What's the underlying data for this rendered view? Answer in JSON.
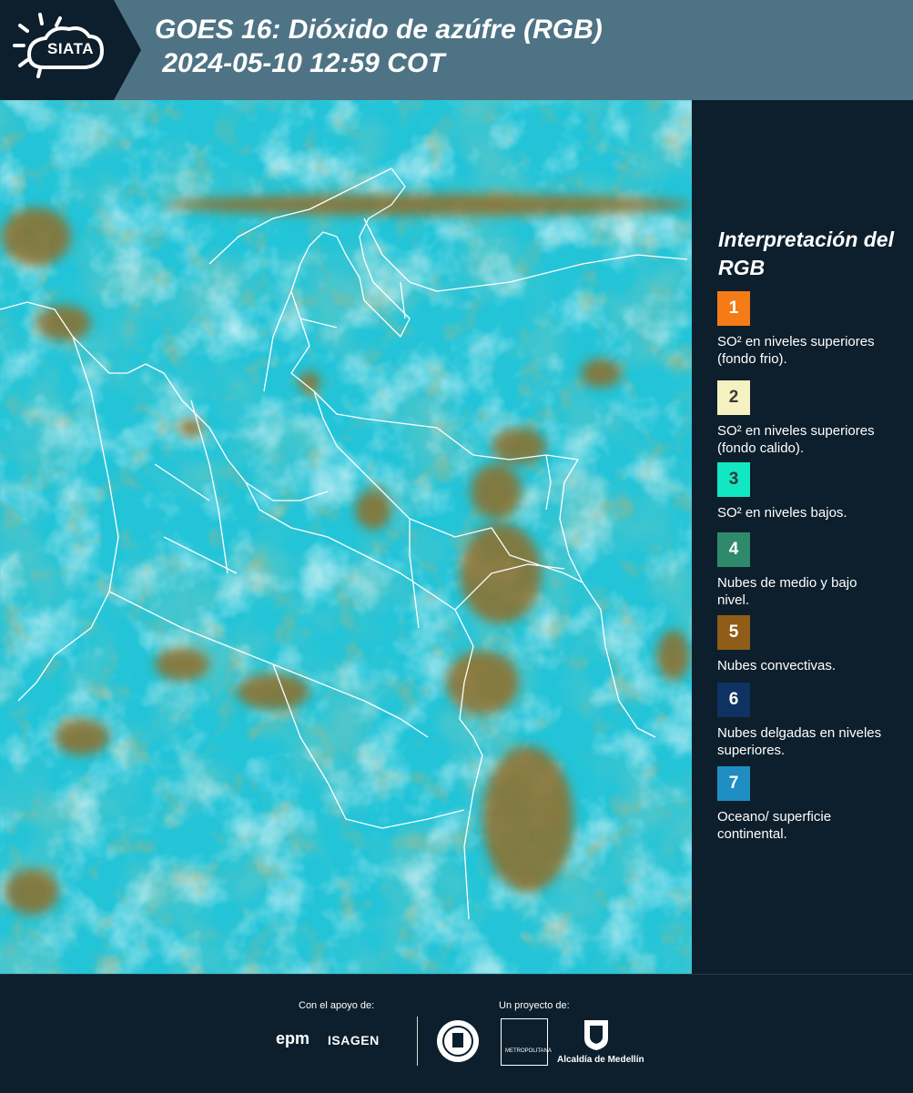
{
  "header": {
    "logo_text": "SIATA",
    "title": "GOES 16: Dióxido de azúfre (RGB)\n 2024-05-10 12:59 COT"
  },
  "legend": {
    "title": "Interpretación del RGB",
    "items": [
      {
        "number": "1",
        "color": "#f47b16",
        "text_color": "#ffffff",
        "text": "SO² en niveles superiores (fondo frio)."
      },
      {
        "number": "2",
        "color": "#f6f1c1",
        "text_color": "#3a3a3a",
        "text": "SO² en niveles superiores (fondo calido)."
      },
      {
        "number": "3",
        "color": "#12e7c3",
        "text_color": "#2a3a3a",
        "text": "SO² en niveles bajos."
      },
      {
        "number": "4",
        "color": "#2f8a6c",
        "text_color": "#ffffff",
        "text": "Nubes de medio y bajo nivel."
      },
      {
        "number": "5",
        "color": "#8f5d17",
        "text_color": "#ffffff",
        "text": "Nubes convectivas."
      },
      {
        "number": "6",
        "color": "#0e3262",
        "text_color": "#ffffff",
        "text": "Nubes delgadas en niveles superiores."
      },
      {
        "number": "7",
        "color": "#1e8ec2",
        "text_color": "#ffffff",
        "text": "Oceano/ superficie continental."
      }
    ]
  },
  "footer": {
    "support_label": "Con el apoyo de:",
    "project_label": "Un proyecto de:",
    "epm": "epm",
    "isagen": "ISAGEN",
    "area_text": "METROPOLITANA",
    "alcaldia": "Alcaldía de Medellín"
  },
  "colors": {
    "background": "#0d1f2c",
    "header": "#4e7384",
    "map_cyan": "#23c7d9",
    "convective": "#8f6e2a"
  }
}
